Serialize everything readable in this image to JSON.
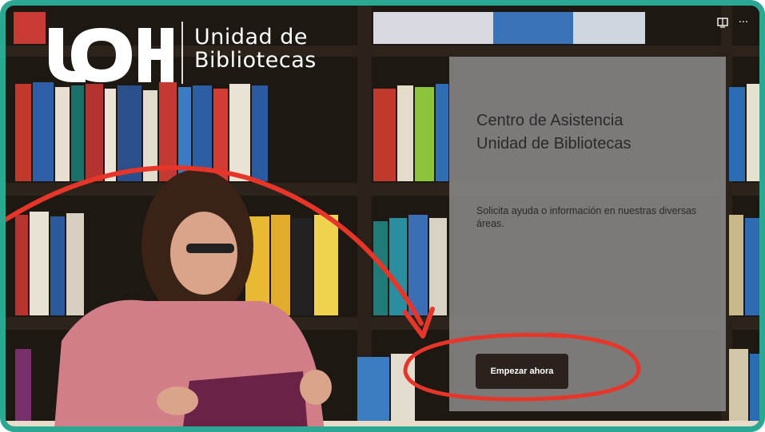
{
  "brand": {
    "logo_mark": "UDD",
    "name_line1": "Unidad de",
    "name_line2": "Bibliotecas"
  },
  "toolbar": {
    "icons": [
      "immersive-reader-icon",
      "more-icon"
    ],
    "more_label": "···"
  },
  "panel": {
    "title_line1": "Centro de Asistencia",
    "title_line2": "Unidad de Bibliotecas",
    "description": "Solicita ayuda o información en nuestras diversas áreas.",
    "start_button": "Empezar ahora"
  },
  "colors": {
    "frame": "#2aa893",
    "annotation": "#e8352a",
    "button": "#2b221e",
    "panel": "#969696"
  }
}
